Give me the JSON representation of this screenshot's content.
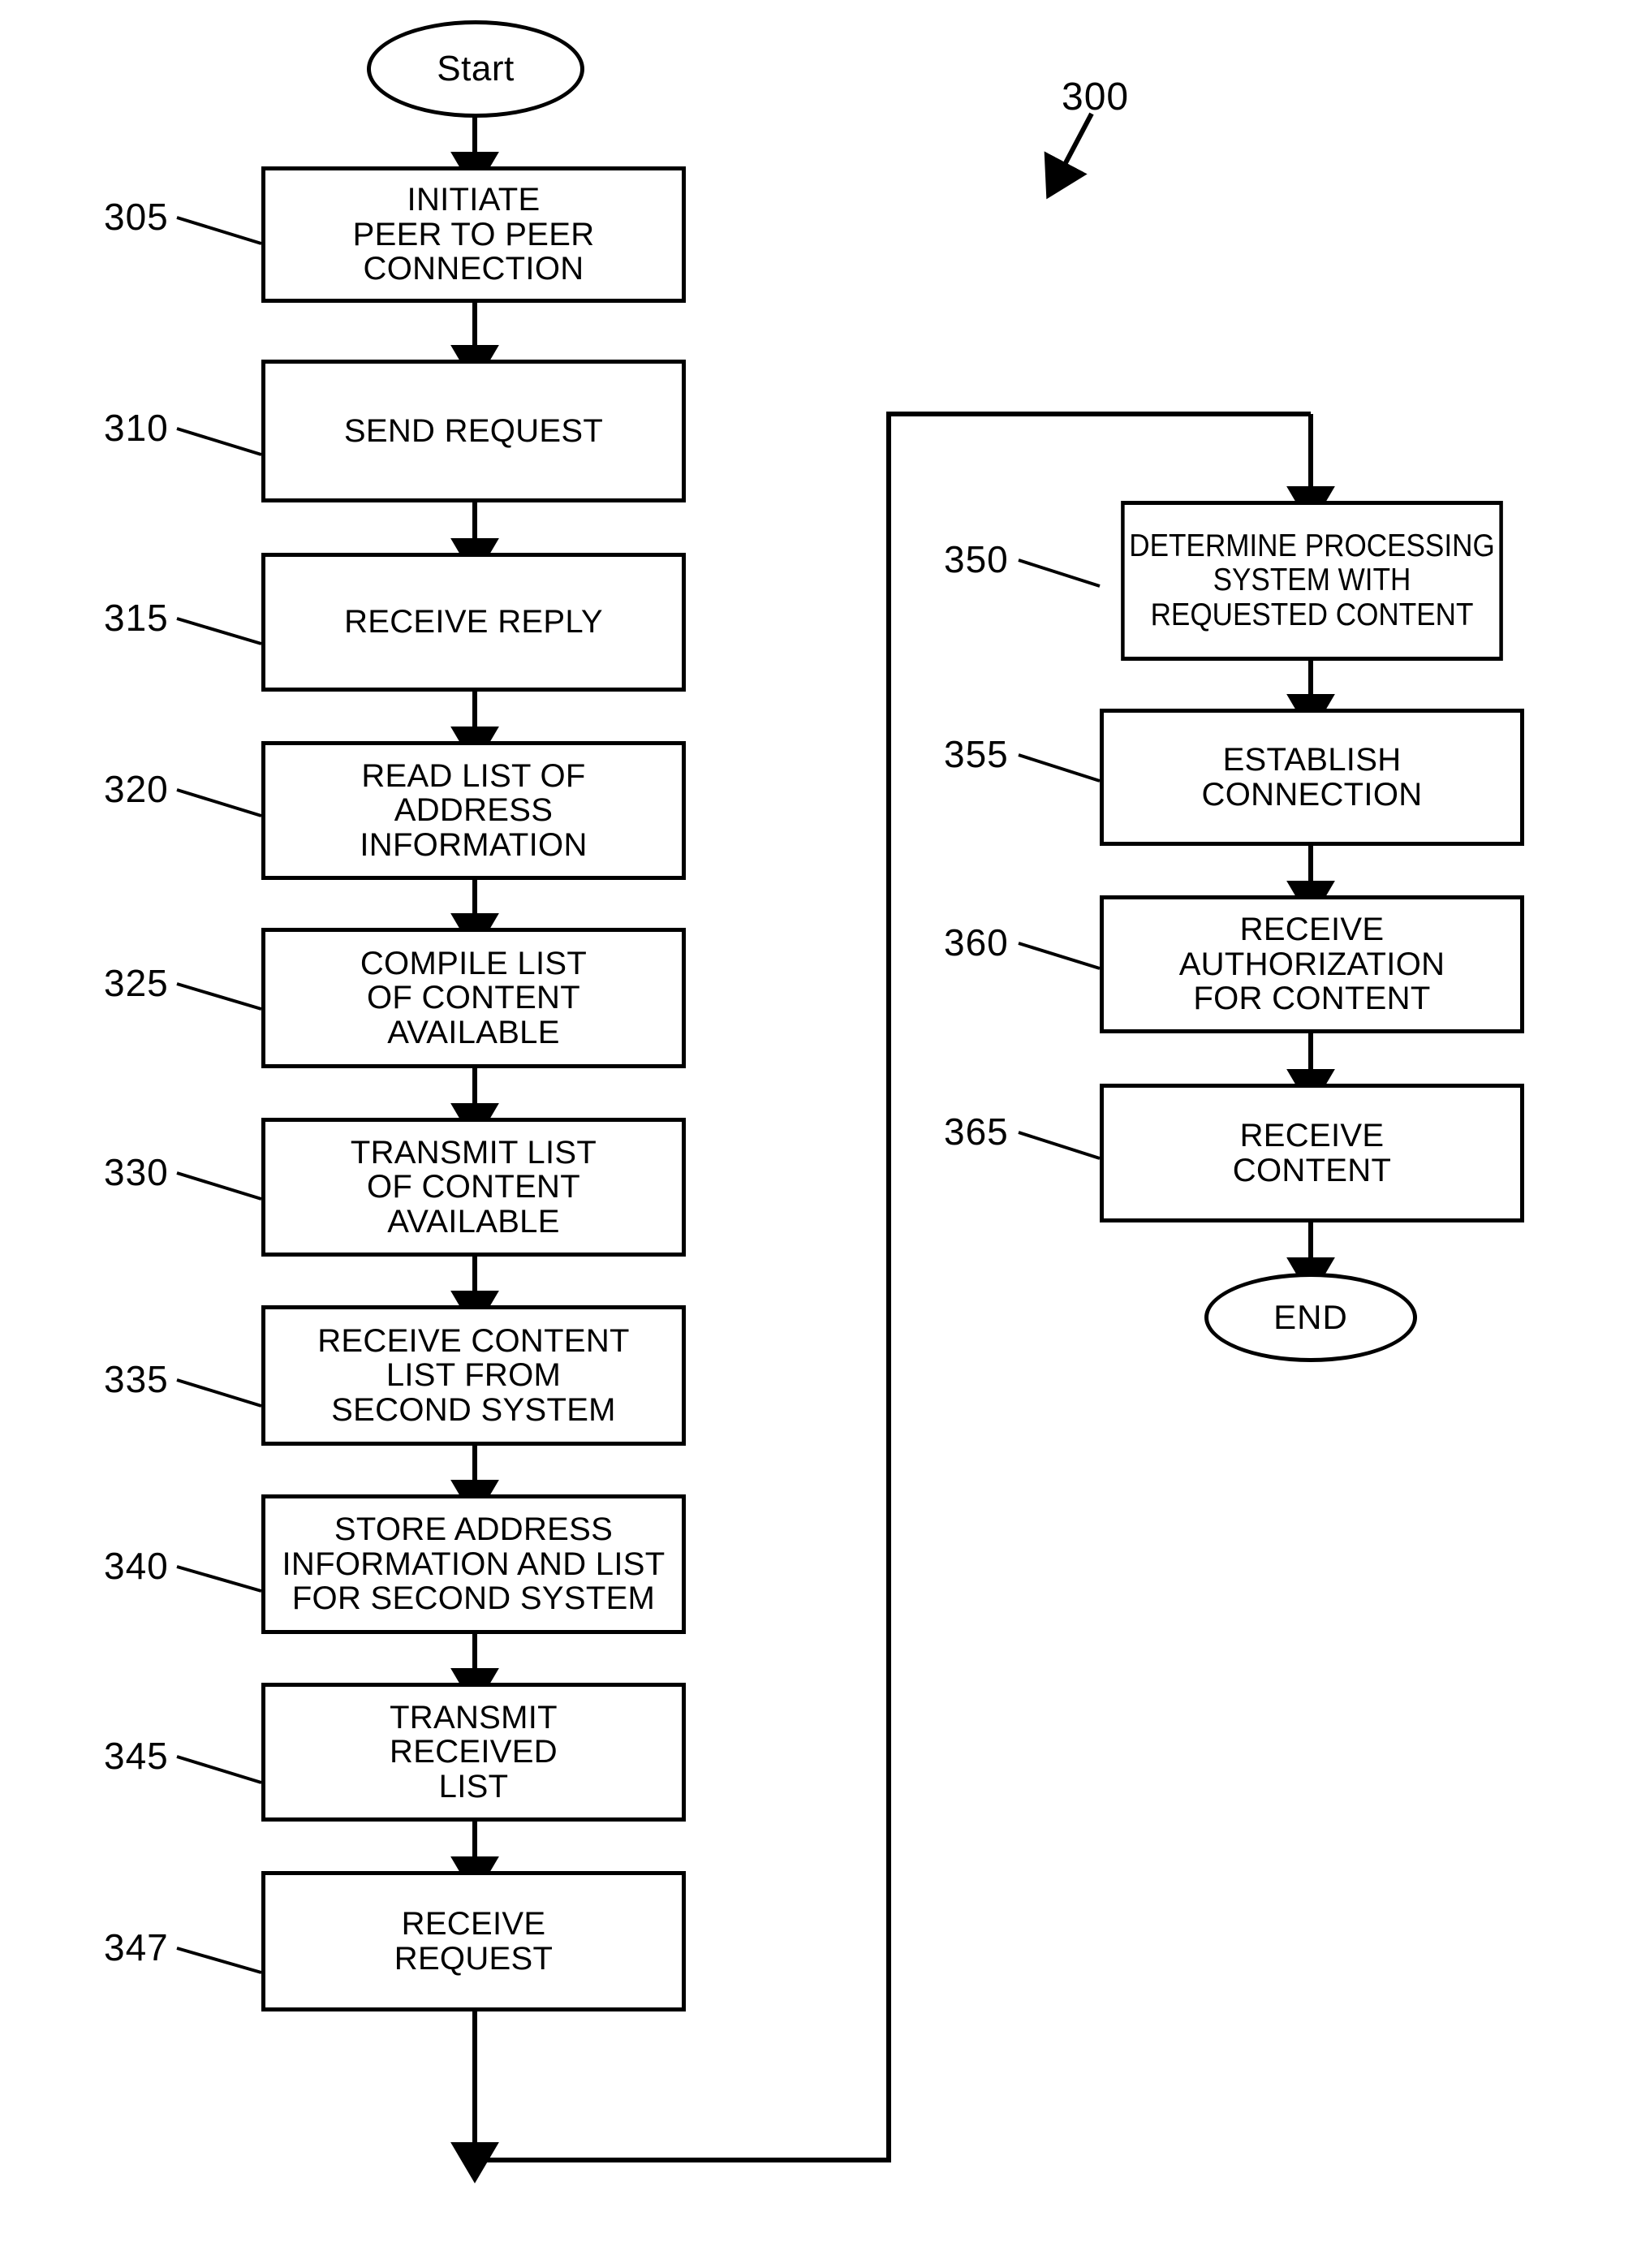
{
  "figure": {
    "label": "300",
    "start_label": "Start",
    "end_label": "END"
  },
  "flow": {
    "left_column": [
      {
        "ref": "305",
        "text": "INITIATE\nPEER TO PEER\nCONNECTION"
      },
      {
        "ref": "310",
        "text": "SEND REQUEST"
      },
      {
        "ref": "315",
        "text": "RECEIVE REPLY"
      },
      {
        "ref": "320",
        "text": "READ LIST OF\nADDRESS\nINFORMATION"
      },
      {
        "ref": "325",
        "text": "COMPILE LIST\nOF CONTENT\nAVAILABLE"
      },
      {
        "ref": "330",
        "text": "TRANSMIT LIST\nOF CONTENT\nAVAILABLE"
      },
      {
        "ref": "335",
        "text": "RECEIVE CONTENT\nLIST FROM\nSECOND SYSTEM"
      },
      {
        "ref": "340",
        "text": "STORE ADDRESS\nINFORMATION AND LIST\nFOR SECOND SYSTEM"
      },
      {
        "ref": "345",
        "text": "TRANSMIT\nRECEIVED\nLIST"
      },
      {
        "ref": "347",
        "text": "RECEIVE\nREQUEST"
      }
    ],
    "right_column": [
      {
        "ref": "350",
        "text": "DETERMINE PROCESSING\nSYSTEM WITH\nREQUESTED CONTENT"
      },
      {
        "ref": "355",
        "text": "ESTABLISH\nCONNECTION"
      },
      {
        "ref": "360",
        "text": "RECEIVE\nAUTHORIZATION\nFOR CONTENT"
      },
      {
        "ref": "365",
        "text": "RECEIVE\nCONTENT"
      }
    ]
  },
  "colors": {
    "ink": "#000000",
    "paper": "#ffffff"
  }
}
